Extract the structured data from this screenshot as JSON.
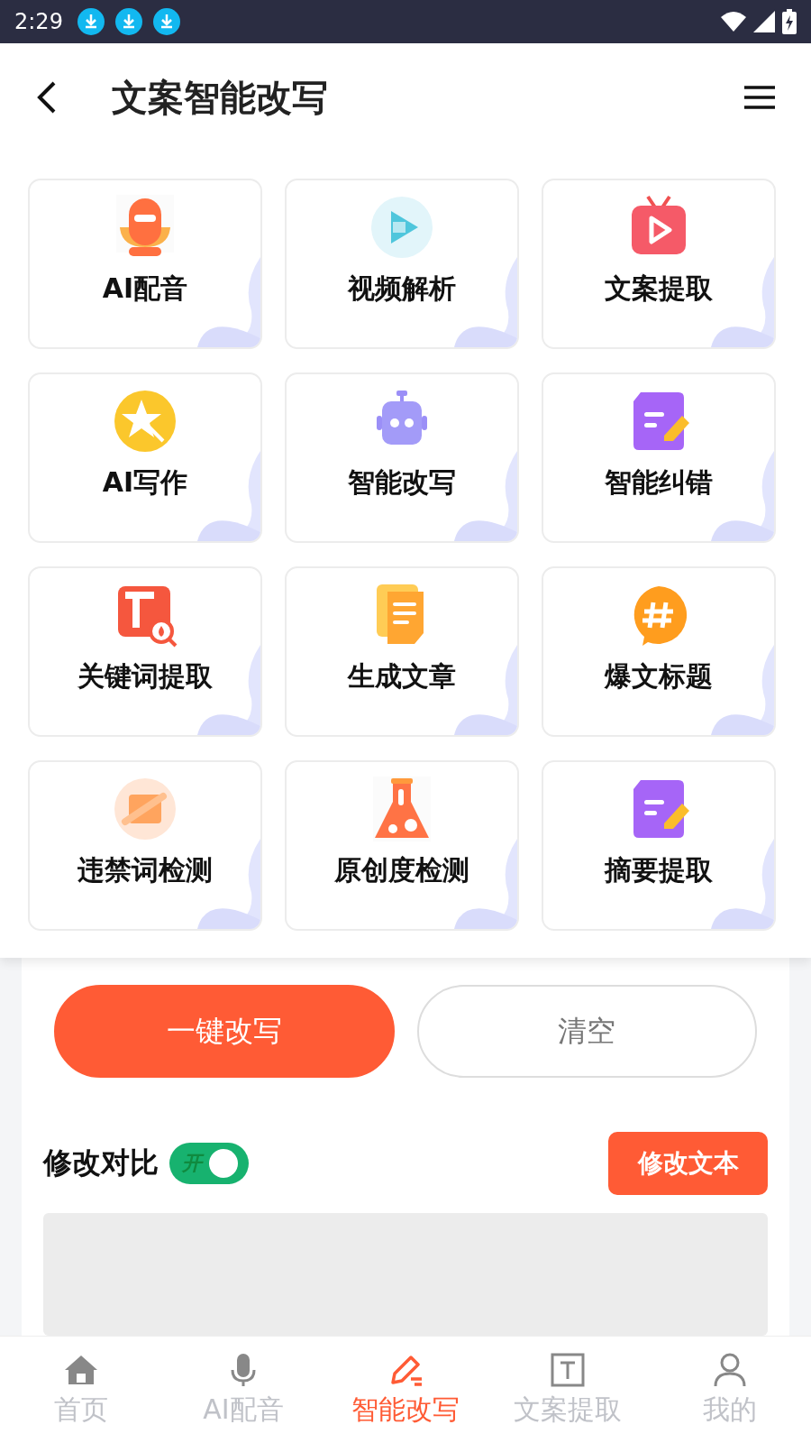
{
  "status_bar": {
    "time": "2:29"
  },
  "header": {
    "title": "文案智能改写"
  },
  "tools": [
    {
      "label": "AI配音"
    },
    {
      "label": "视频解析"
    },
    {
      "label": "文案提取"
    },
    {
      "label": "AI写作"
    },
    {
      "label": "智能改写"
    },
    {
      "label": "智能纠错"
    },
    {
      "label": "关键词提取"
    },
    {
      "label": "生成文章"
    },
    {
      "label": "爆文标题"
    },
    {
      "label": "违禁词检测"
    },
    {
      "label": "原创度检测"
    },
    {
      "label": "摘要提取"
    }
  ],
  "actions": [
    {
      "label": "一键改写",
      "kind": "primary"
    },
    {
      "label": "清空",
      "kind": "outline"
    }
  ],
  "compare": {
    "label": "修改对比",
    "switch_text": "开",
    "on": true,
    "button": "修改文本"
  },
  "bottom_nav": [
    {
      "label": "首页",
      "selected": false
    },
    {
      "label": "AI配音",
      "selected": false
    },
    {
      "label": "智能改写",
      "selected": true
    },
    {
      "label": "文案提取",
      "selected": false
    },
    {
      "label": "我的",
      "selected": false
    }
  ]
}
